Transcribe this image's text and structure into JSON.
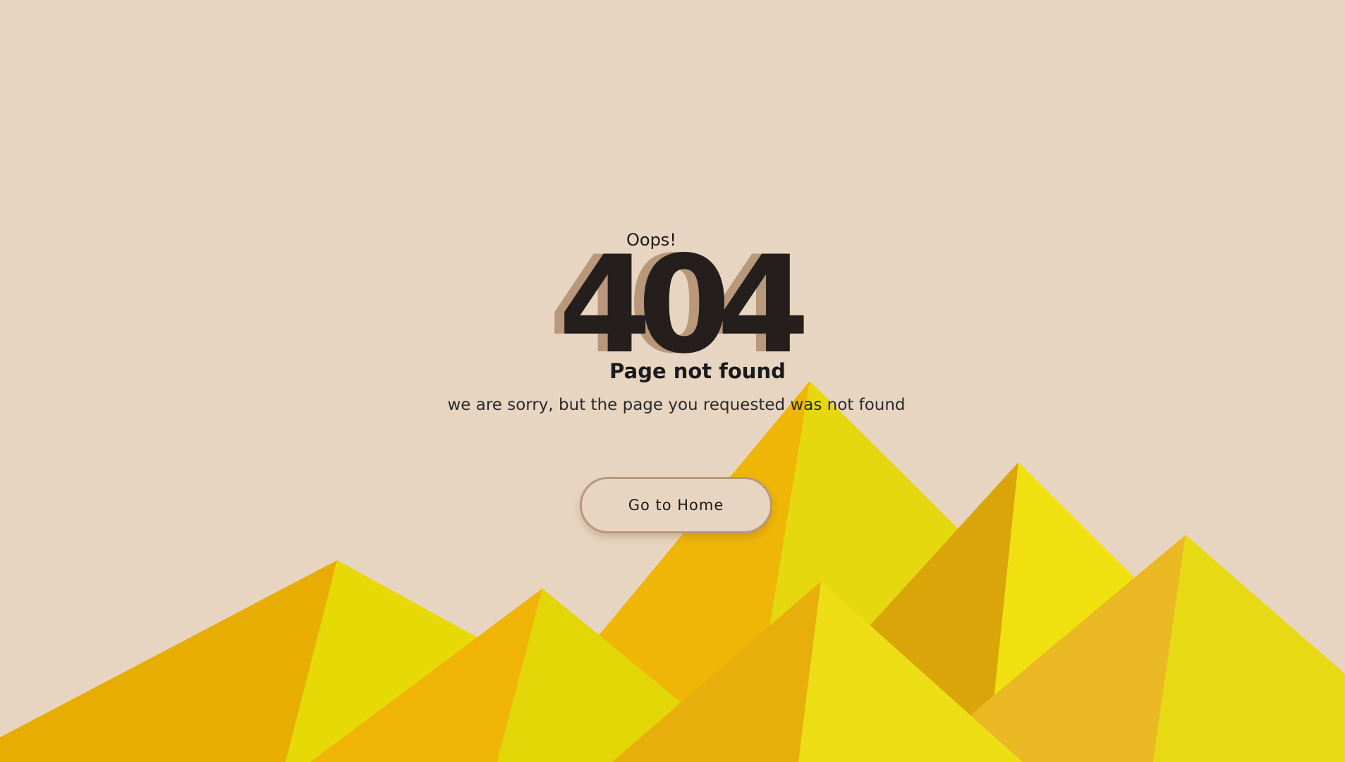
{
  "error": {
    "oops": "Oops!",
    "code": "404",
    "title": "Page not found",
    "message": "we are sorry, but the page you requested was not found"
  },
  "actions": {
    "home_label": "Go to Home"
  },
  "colors": {
    "background": "#e8d5c1",
    "code_fill": "#241f1c",
    "code_shadow": "#b9977a",
    "button_border": "#b9977a"
  }
}
